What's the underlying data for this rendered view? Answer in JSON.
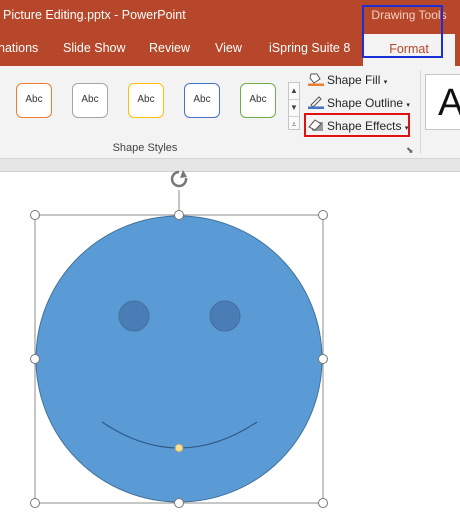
{
  "window": {
    "title": "Picture Editing.pptx  -  PowerPoint"
  },
  "contextual_tab_group": {
    "label": "Drawing Tools"
  },
  "tabs": [
    {
      "label": "nations"
    },
    {
      "label": "Slide Show"
    },
    {
      "label": "Review"
    },
    {
      "label": "View"
    },
    {
      "label": "iSpring Suite 8"
    },
    {
      "label": "Format"
    }
  ],
  "shape_styles": {
    "thumbnails": [
      {
        "label": "Abc",
        "border_color": "#ed7d31"
      },
      {
        "label": "Abc",
        "border_color": "#a5a5a5"
      },
      {
        "label": "Abc",
        "border_color": "#ffc000"
      },
      {
        "label": "Abc",
        "border_color": "#4472c4"
      },
      {
        "label": "Abc",
        "border_color": "#70ad47"
      }
    ],
    "group_label": "Shape Styles",
    "commands": {
      "fill": "Shape Fill",
      "outline": "Shape Outline",
      "effects": "Shape Effects"
    }
  },
  "wordart": {
    "preview_text": "A"
  },
  "colors": {
    "brand": "#b7472a",
    "shape_fill": "#5b9bd5",
    "shape_stroke": "#41719c",
    "eye_fill": "#4a7db5",
    "highlight_blue": "#1b2fd6",
    "highlight_red": "#e01010"
  }
}
